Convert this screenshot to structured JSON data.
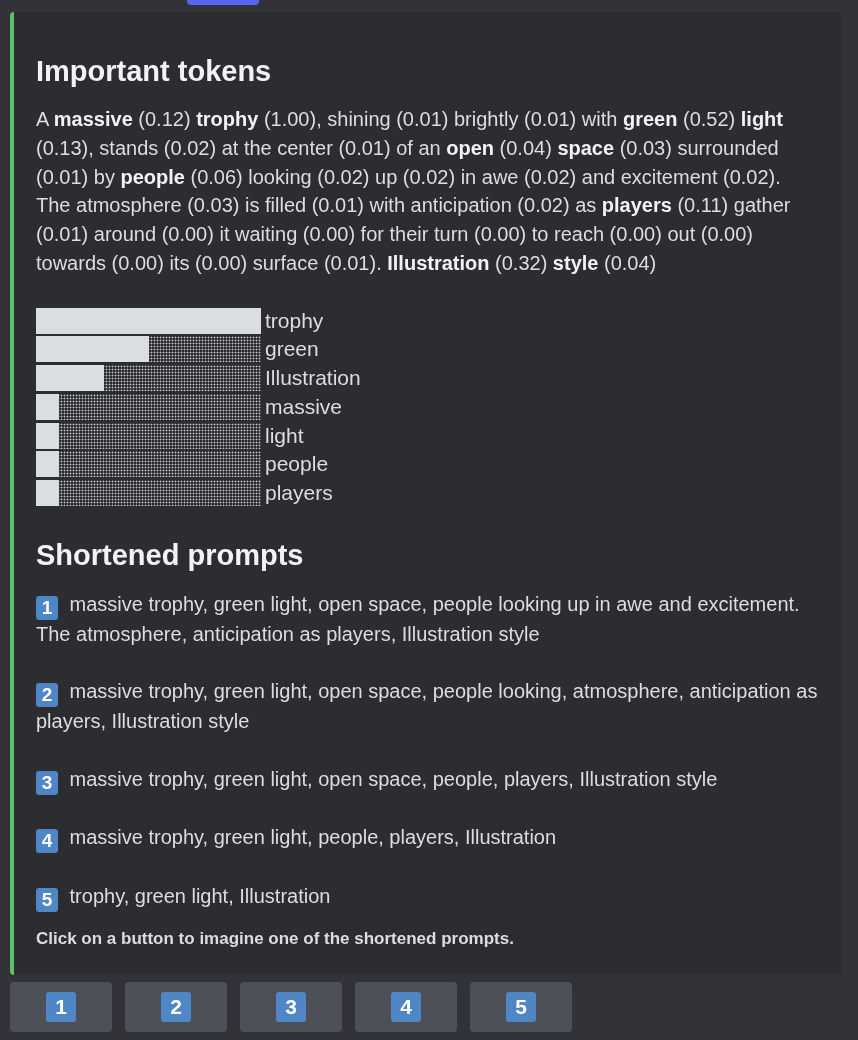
{
  "important_tokens": {
    "title": "Important tokens",
    "text": "A **massive** (0.12) **trophy** (1.00), shining (0.01) brightly (0.01) with **green** (0.52) **light** (0.13), stands (0.02) at the center (0.01) of an **open** (0.04) **space** (0.03) surrounded (0.01) by **people** (0.06) looking (0.02) up (0.02) in awe (0.02) and excitement (0.02). The atmosphere (0.03) is filled (0.01) with anticipation (0.02) as **players** (0.11) gather (0.01) around (0.00) it waiting (0.00) for their turn (0.00) to reach (0.00) out (0.00) towards (0.00) its (0.00) surface (0.01). **Illustration** (0.32) **style** (0.04)"
  },
  "token_bars": [
    {
      "token": "trophy",
      "level": 1.0
    },
    {
      "token": "green",
      "level": 0.5
    },
    {
      "token": "Illustration",
      "level": 0.3
    },
    {
      "token": "massive",
      "level": 0.1
    },
    {
      "token": "light",
      "level": 0.1
    },
    {
      "token": "people",
      "level": 0.1
    },
    {
      "token": "players",
      "level": 0.1
    }
  ],
  "shortened_prompts": {
    "title": "Shortened prompts",
    "items": [
      {
        "number": "1",
        "text": "massive trophy, green light, open space, people looking up in awe and excitement. The atmosphere, anticipation as players, Illustration style"
      },
      {
        "number": "2",
        "text": "massive trophy, green light, open space, people looking, atmosphere, anticipation as players, Illustration style"
      },
      {
        "number": "3",
        "text": "massive trophy, green light, open space, people, players, Illustration style"
      },
      {
        "number": "4",
        "text": "massive trophy, green light, people, players, Illustration"
      },
      {
        "number": "5",
        "text": "trophy, green light, Illustration"
      }
    ]
  },
  "hint": "Click on a button to imagine one of the shortened prompts.",
  "buttons": [
    {
      "label": "1"
    },
    {
      "label": "2"
    },
    {
      "label": "3"
    },
    {
      "label": "4"
    },
    {
      "label": "5"
    }
  ]
}
